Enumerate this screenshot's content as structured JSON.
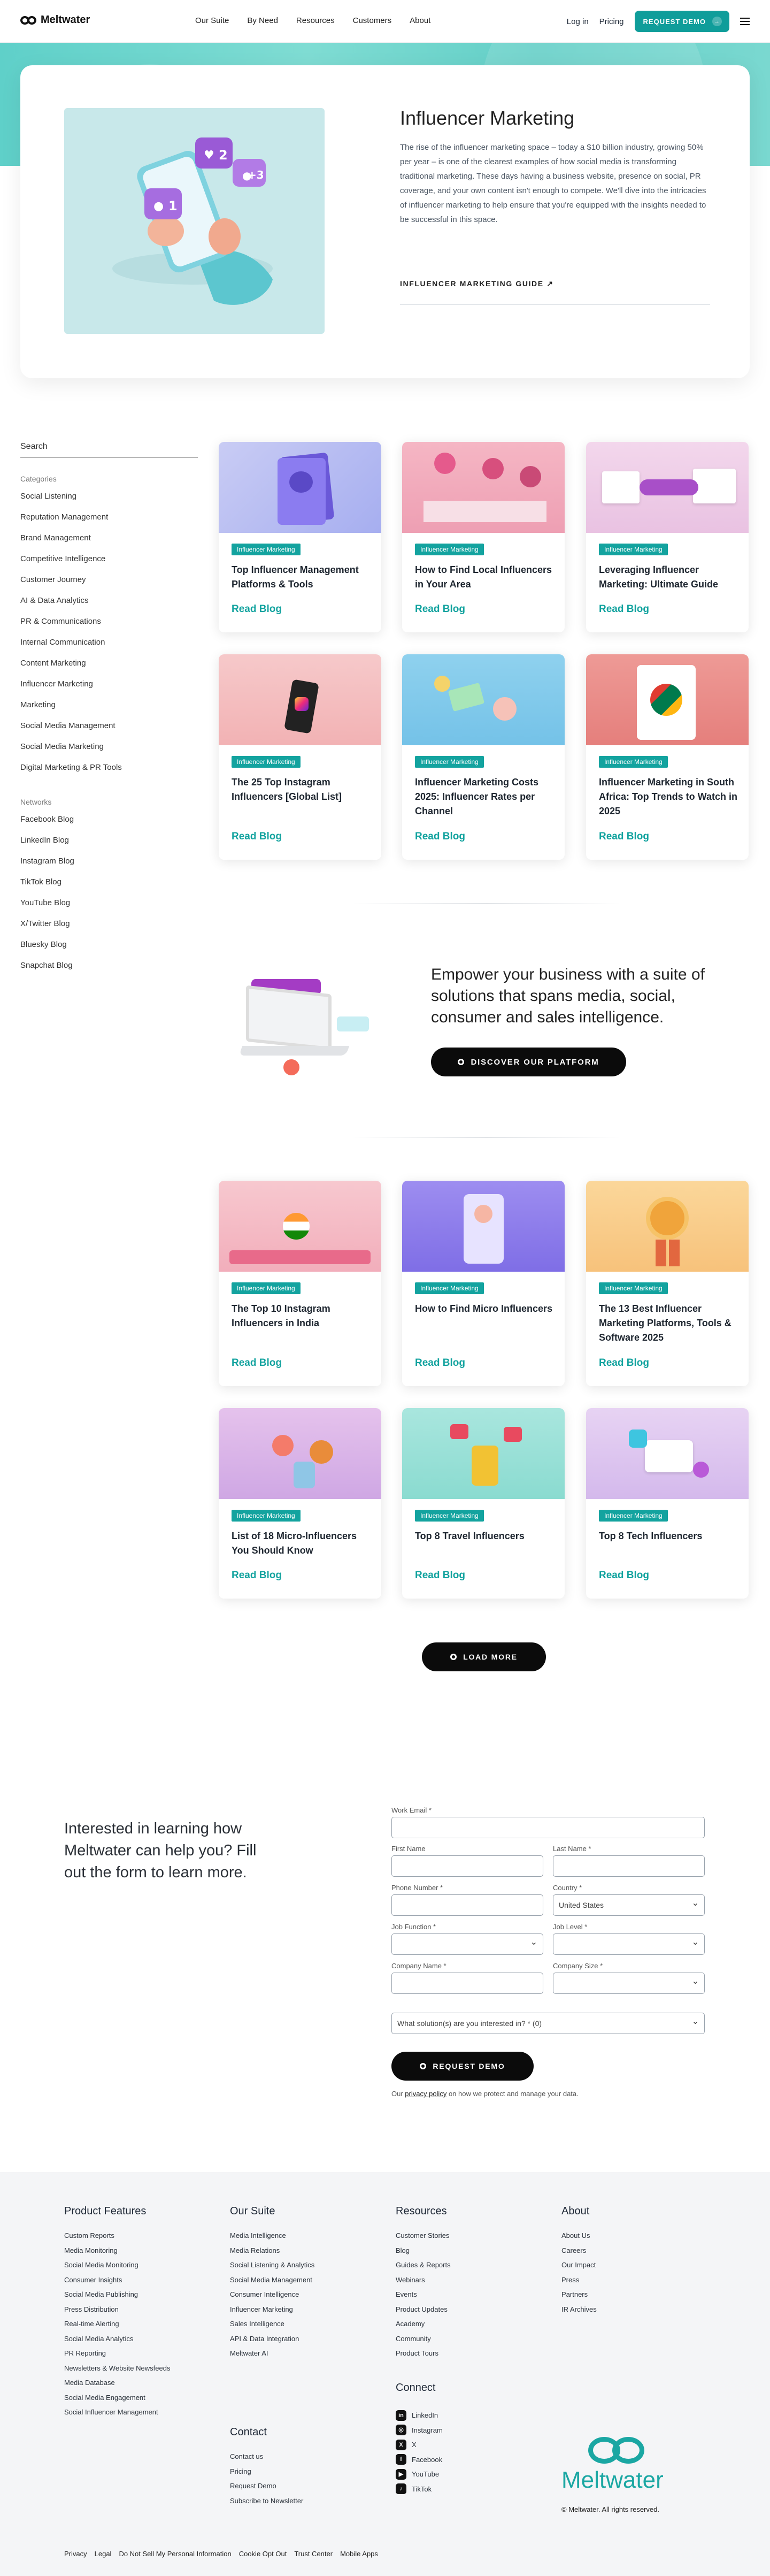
{
  "nav": {
    "logo": "Meltwater",
    "menu": [
      "Our Suite",
      "By Need",
      "Resources",
      "Customers",
      "About"
    ],
    "login": "Log in",
    "pricing": "Pricing",
    "demo": "REQUEST DEMO"
  },
  "hero": {
    "title": "Influencer Marketing",
    "description": "The rise of the influencer marketing space – today a $10 billion industry, growing 50% per year – is one of the clearest examples of how social media is transforming traditional marketing. These days having a business website, presence on social, PR coverage, and your own content isn't enough to compete. We'll dive into the intricacies of influencer marketing to help ensure that you're equipped with the insights needed to be successful in this space.",
    "guide_link": "INFLUENCER MARKETING GUIDE ↗",
    "badges": [
      "2",
      "+3",
      "1"
    ]
  },
  "sidebar": {
    "search": "Search",
    "categories_heading": "Categories",
    "categories": [
      "Social Listening",
      "Reputation Management",
      "Brand Management",
      "Competitive Intelligence",
      "Customer Journey",
      "AI & Data Analytics",
      "PR & Communications",
      "Internal Communication",
      "Content Marketing",
      "Influencer Marketing",
      "Marketing",
      "Social Media Management",
      "Social Media Marketing",
      "Digital Marketing & PR Tools"
    ],
    "networks_heading": "Networks",
    "networks": [
      "Facebook Blog",
      "LinkedIn Blog",
      "Instagram Blog",
      "TikTok Blog",
      "YouTube Blog",
      "X/Twitter Blog",
      "Bluesky Blog",
      "Snapchat Blog"
    ]
  },
  "cards": [
    {
      "tag": "Influencer Marketing",
      "title": "Top Influencer Management Platforms & Tools",
      "read": "Read Blog"
    },
    {
      "tag": "Influencer Marketing",
      "title": "How to Find Local Influencers in Your Area",
      "read": "Read Blog"
    },
    {
      "tag": "Influencer Marketing",
      "title": "Leveraging Influencer Marketing: Ultimate Guide",
      "read": "Read Blog"
    },
    {
      "tag": "Influencer Marketing",
      "title": "The 25 Top Instagram Influencers [Global List]",
      "read": "Read Blog"
    },
    {
      "tag": "Influencer Marketing",
      "title": "Influencer Marketing Costs 2025: Influencer Rates per Channel",
      "read": "Read Blog"
    },
    {
      "tag": "Influencer Marketing",
      "title": "Influencer Marketing in South Africa: Top Trends to Watch in 2025",
      "read": "Read Blog"
    },
    {
      "tag": "Influencer Marketing",
      "title": "The Top 10 Instagram Influencers in India",
      "read": "Read Blog"
    },
    {
      "tag": "Influencer Marketing",
      "title": "How to Find Micro Influencers",
      "read": "Read Blog"
    },
    {
      "tag": "Influencer Marketing",
      "title": "The 13 Best Influencer Marketing Platforms, Tools & Software 2025",
      "read": "Read Blog"
    },
    {
      "tag": "Influencer Marketing",
      "title": "List of 18 Micro-Influencers You Should Know",
      "read": "Read Blog"
    },
    {
      "tag": "Influencer Marketing",
      "title": "Top 8 Travel Influencers",
      "read": "Read Blog"
    },
    {
      "tag": "Influencer Marketing",
      "title": "Top 8 Tech Influencers",
      "read": "Read Blog"
    }
  ],
  "promo": {
    "title": "Empower your business with a suite of solutions that spans media, social, consumer and sales intelligence.",
    "button": "DISCOVER OUR PLATFORM"
  },
  "load_more": "LOAD MORE",
  "form": {
    "intro": "Interested in learning how Meltwater can help you? Fill out the form to learn more.",
    "work_email": "Work Email *",
    "first_name": "First Name",
    "last_name": "Last Name *",
    "phone": "Phone Number *",
    "country": "Country *",
    "country_value": "United States",
    "job_function": "Job Function *",
    "job_level": "Job Level *",
    "company_name": "Company Name *",
    "company_size": "Company Size *",
    "solution": "What solution(s) are you interested in? * (0)",
    "submit": "REQUEST DEMO",
    "privacy_pre": "Our ",
    "privacy_link": "privacy policy",
    "privacy_post": " on how we protect and manage your data."
  },
  "footer": {
    "product_features": {
      "heading": "Product Features",
      "items": [
        "Custom Reports",
        "Media Monitoring",
        "Social Media Monitoring",
        "Consumer Insights",
        "Social Media Publishing",
        "Press Distribution",
        "Real-time Alerting",
        "Social Media Analytics",
        "PR Reporting",
        "Newsletters & Website Newsfeeds",
        "Media Database",
        "Social Media Engagement",
        "Social Influencer Management"
      ]
    },
    "our_suite": {
      "heading": "Our Suite",
      "items": [
        "Media Intelligence",
        "Media Relations",
        "Social Listening & Analytics",
        "Social Media Management",
        "Consumer Intelligence",
        "Influencer Marketing",
        "Sales Intelligence",
        "API & Data Integration",
        "Meltwater AI"
      ]
    },
    "resources": {
      "heading": "Resources",
      "items": [
        "Customer Stories",
        "Blog",
        "Guides & Reports",
        "Webinars",
        "Events",
        "Product Updates",
        "Academy",
        "Community",
        "Product Tours"
      ]
    },
    "about": {
      "heading": "About",
      "items": [
        "About Us",
        "Careers",
        "Our Impact",
        "Press",
        "Partners",
        "IR Archives"
      ]
    },
    "contact": {
      "heading": "Contact",
      "items": [
        "Contact us",
        "Pricing",
        "Request Demo",
        "Subscribe to Newsletter"
      ]
    },
    "connect": {
      "heading": "Connect",
      "items": [
        {
          "label": "LinkedIn",
          "icon": "in"
        },
        {
          "label": "Instagram",
          "icon": "◎"
        },
        {
          "label": "X",
          "icon": "X"
        },
        {
          "label": "Facebook",
          "icon": "f"
        },
        {
          "label": "YouTube",
          "icon": "▶"
        },
        {
          "label": "TikTok",
          "icon": "♪"
        }
      ]
    },
    "brand": "Meltwater",
    "copyright": "© Meltwater. All rights reserved.",
    "bottom_links": [
      "Privacy",
      "Legal",
      "Do Not Sell My Personal Information",
      "Cookie Opt Out",
      "Trust Center",
      "Mobile Apps"
    ]
  },
  "colors": {
    "accent": "#13a39f",
    "hero_bg": "#63cfc7",
    "footer_bg": "#f4f5f7"
  }
}
